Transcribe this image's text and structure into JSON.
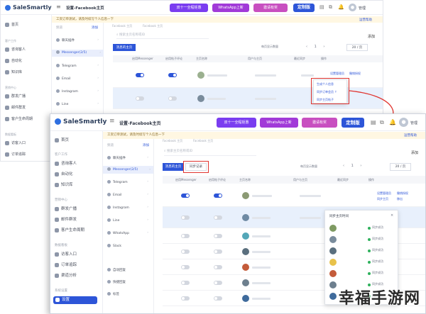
{
  "brand": "SaleSmartly",
  "page_title": "设置-Facebook主页",
  "notice": "工资订单测试，请及时续写个人信息一下",
  "promos": [
    {
      "label": "双十一全程钜惠",
      "color": "#7a3df0"
    },
    {
      "label": "WhatsApp上新",
      "color": "#a13ad8"
    },
    {
      "label": "邀请有奖",
      "color": "#c84fc0"
    }
  ],
  "custom_button": "定制版",
  "user_name": "管理",
  "back_top_link": "运营帮助",
  "sidebar": [
    {
      "kind": "item",
      "label": "首页"
    },
    {
      "kind": "group",
      "label": "客户工作"
    },
    {
      "kind": "item",
      "label": "咨询客人"
    },
    {
      "kind": "item",
      "label": "自动化"
    },
    {
      "kind": "item",
      "label": "知识库"
    },
    {
      "kind": "group",
      "label": "营销中心"
    },
    {
      "kind": "item",
      "label": "群发广播"
    },
    {
      "kind": "item",
      "label": "邮件群发"
    },
    {
      "kind": "item",
      "label": "客户生命周期"
    },
    {
      "kind": "group",
      "label": "数据看板"
    },
    {
      "kind": "item",
      "label": "访客入口"
    },
    {
      "kind": "item",
      "label": "订单追踪"
    },
    {
      "kind": "item",
      "label": "渠道分析"
    },
    {
      "kind": "group",
      "label": "系统设置"
    },
    {
      "kind": "item",
      "label": "设置",
      "active": true
    }
  ],
  "channels_header": "频道",
  "channels_action": "添加",
  "channels": [
    {
      "label": "聊天插件"
    },
    {
      "label": "Messenger(2/5)",
      "active": true
    },
    {
      "label": "Telegram"
    },
    {
      "label": "Email"
    },
    {
      "label": "Instagram"
    },
    {
      "label": "Line"
    },
    {
      "label": "WhatsApp"
    },
    {
      "label": "Slack"
    }
  ],
  "channels_lower": [
    "自动回复",
    "快捷回复",
    "标签"
  ],
  "back_tabs": [
    "Facebook 主页",
    "Facebook 主页"
  ],
  "search_placeholder": "搜索主页名称或ID",
  "add_button": "添加",
  "tabs": [
    "消息的主页",
    "同步记录"
  ],
  "columns": [
    "启用Messenger",
    "启用帖子评论",
    "主页名称",
    "用户与主页",
    "最近同步",
    "操作"
  ],
  "per_page_text": "每页显示数量",
  "pagination": {
    "prev": "‹",
    "current": "1",
    "next": "›",
    "page_size": "20 / 页"
  },
  "rows": [
    {
      "messenger": true,
      "comments": true,
      "avatar": "#9bb08f",
      "highlight": false
    },
    {
      "messenger": true,
      "comments": true,
      "avatar": "#7a8c9c",
      "highlight": true
    },
    {
      "messenger": false,
      "comments": false,
      "avatar": "#4aa9b9",
      "highlight": false,
      "avatar_letter": "N"
    }
  ],
  "front_rows": [
    {
      "messenger": true,
      "comments": true,
      "avatar": "#8b9a74",
      "highlight": false
    },
    {
      "messenger": false,
      "comments": false,
      "avatar": "#6f8aa3",
      "highlight": true
    },
    {
      "messenger": false,
      "comments": false,
      "avatar": "#53a7b8",
      "highlight": false,
      "avatar_letter": "N"
    },
    {
      "messenger": false,
      "comments": false,
      "avatar": "#5a6f7e",
      "highlight": false
    },
    {
      "messenger": false,
      "comments": false,
      "avatar": "#c45b3a",
      "highlight": false
    },
    {
      "messenger": false,
      "comments": false,
      "avatar": "#6d7f8e",
      "highlight": false
    },
    {
      "messenger": false,
      "comments": false,
      "avatar": "#3f6b9c",
      "highlight": false
    }
  ],
  "row_actions": [
    "设置管理员",
    "撤销授权",
    "移出",
    "同步主页"
  ],
  "popup_title": "同步主页时间",
  "popup_items": [
    "同步成功",
    "同步成功",
    "同步成功",
    "同步成功",
    "同步成功",
    "同步成功",
    "同步成功"
  ],
  "menu_options": [
    "生成个人信息",
    "同步订单会员 ↑",
    "同步主页帖子"
  ],
  "watermark": "幸福手游网",
  "colors": {
    "brand": "#2d55d8",
    "highlight_box": "#e0342f",
    "row_highlight": "#e8f0fc"
  }
}
